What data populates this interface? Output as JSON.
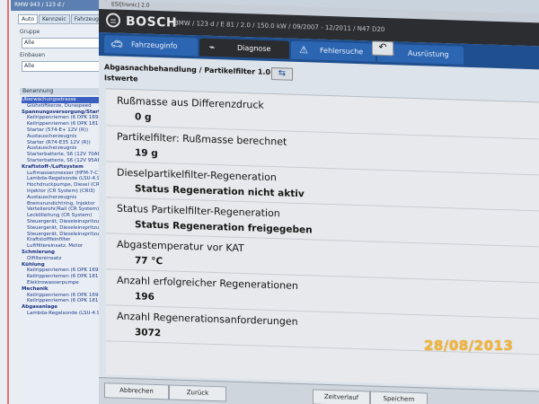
{
  "background_window": {
    "title": "RMW 943 / 123 d /",
    "tabs": [
      "Auto",
      "Kennzeic",
      "Fahrzeug"
    ],
    "field1_label": "Gruppe",
    "field1_value": "Alle",
    "field2_label": "Einbauen",
    "field2_value": "Alle",
    "list_header": "Benennung",
    "tree": [
      {
        "text": "Überwachungsstrasse",
        "style": "sel"
      },
      {
        "text": "Glühstiftkerze, Duraspeed",
        "style": "ind"
      },
      {
        "text": "Spannungsversorgung/Startsy",
        "style": "cat"
      },
      {
        "text": "Keilrippenriemen (6 DPK 1698)",
        "style": "ind"
      },
      {
        "text": "Keilrippenriemen (6 DPK 1817)",
        "style": "ind"
      },
      {
        "text": "Starter (574-E+ 12V (R))",
        "style": "ind"
      },
      {
        "text": "Austauscherzeugnis",
        "style": "ind"
      },
      {
        "text": "Starter (R74-E35 12V (R))",
        "style": "ind"
      },
      {
        "text": "Austauscherzeugnis",
        "style": "ind"
      },
      {
        "text": "Starterbatterie, S6 (12V 70AH)",
        "style": "ind"
      },
      {
        "text": "Starterbatterie, S6 (12V 95AH)",
        "style": "ind"
      },
      {
        "text": "Kraftstoff-/Luftsystem",
        "style": "cat"
      },
      {
        "text": "Luftmassenmesser (HFM-7-C)",
        "style": "ind"
      },
      {
        "text": "Lambda-Regelsonde (LSU-4.9)",
        "style": "ind"
      },
      {
        "text": "Hochdruckpumpe, Diesel (CR)",
        "style": "ind"
      },
      {
        "text": "Injektor (CR System) (CRI3)",
        "style": "ind"
      },
      {
        "text": "Austauscherzeugnis",
        "style": "ind"
      },
      {
        "text": "Bremsrundichtring, Injektor",
        "style": "ind"
      },
      {
        "text": "Verteilerohr/Rail (CR System)",
        "style": "ind"
      },
      {
        "text": "Leckölleitung (CR System)",
        "style": "ind"
      },
      {
        "text": "Steuergerät, Dieseleinspritzung",
        "style": "ind"
      },
      {
        "text": "Steuergerät, Dieseleinspritzung",
        "style": "ind"
      },
      {
        "text": "Steuergerät, Dieseleinspritzung",
        "style": "ind"
      },
      {
        "text": "Kraftstofffeinfilter",
        "style": "ind"
      },
      {
        "text": "Luftfiltereinsatz, Motor",
        "style": "ind"
      },
      {
        "text": "Schmierung",
        "style": "cat"
      },
      {
        "text": "Ölfiltereinsatz",
        "style": "ind"
      },
      {
        "text": "Kühlung",
        "style": "cat"
      },
      {
        "text": "Keilrippenriemen (6 DPK 1698)",
        "style": "ind"
      },
      {
        "text": "Keilrippenriemen (6 DPK 1817)",
        "style": "ind"
      },
      {
        "text": "Elektrowasserpumpe",
        "style": "ind"
      },
      {
        "text": "Mechanik",
        "style": "cat"
      },
      {
        "text": "Keilrippenriemen (6 DPK 1698)",
        "style": "ind"
      },
      {
        "text": "Keilrippenriemen (6 DPK 1817)",
        "style": "ind"
      },
      {
        "text": "Abgasanlage",
        "style": "cat"
      },
      {
        "text": "Lambda-Regelsonde (LSU-4.9)",
        "style": "ind"
      }
    ]
  },
  "window": {
    "title": "ESI[tronic] 2.0"
  },
  "header": {
    "brand": "BOSCH",
    "vehicle": "BMW / 123 d / E 81 / 2.0 / 150.0 kW / 09/2007 - 12/2011 / N47 D20"
  },
  "nav": {
    "tabs": [
      {
        "label": "Fahrzeuginfo",
        "icon": "car-icon"
      },
      {
        "label": "Diagnose",
        "icon": "diagnosis-icon"
      },
      {
        "label": "Fehlersuche",
        "icon": "troubleshoot-icon"
      },
      {
        "label": "Ausrüstung",
        "icon": "book-icon"
      }
    ],
    "back_symbol": "↶"
  },
  "breadcrumb": "Abgasnachbehandlung / Partikelfilter 1.0",
  "section_title": "Istwerte",
  "values": [
    {
      "label": "Rußmasse aus Differenzdruck",
      "value": "0 g"
    },
    {
      "label": "Partikelfilter: Rußmasse berechnet",
      "value": "19 g"
    },
    {
      "label": "Dieselpartikelfilter-Regeneration",
      "value": "Status Regeneration nicht aktiv"
    },
    {
      "label": "Status Partikelfilter-Regeneration",
      "value": "Status Regeneration freigegeben"
    },
    {
      "label": "Abgastemperatur vor KAT",
      "value": "77 °C"
    },
    {
      "label": "Anzahl erfolgreicher Regenerationen",
      "value": "196"
    },
    {
      "label": "Anzahl Regenerationsanforderungen",
      "value": "3072"
    }
  ],
  "footer": {
    "buttons": [
      "Abbrechen",
      "Zurück",
      "Zeitverlauf",
      "Speichern"
    ]
  },
  "camera_date": "28/08/2013"
}
